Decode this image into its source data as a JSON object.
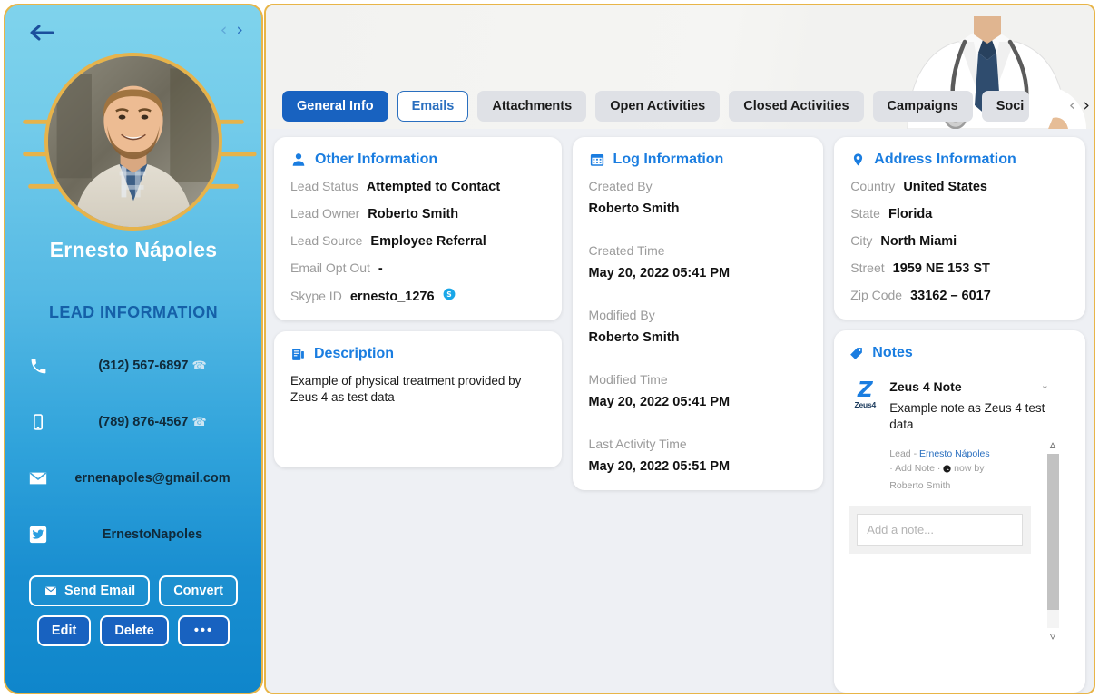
{
  "sidebar": {
    "back_icon": "back-arrow-icon",
    "prev_icon": "chevron-left-icon",
    "next_icon": "chevron-right-icon",
    "lead_name": "Ernesto Nápoles",
    "section_title": "LEAD INFORMATION",
    "contacts": [
      {
        "icon": "phone-icon",
        "value": "(312) 567-6897",
        "call_icon": "call-icon"
      },
      {
        "icon": "mobile-icon",
        "value": "(789) 876-4567",
        "call_icon": "call-icon"
      },
      {
        "icon": "email-icon",
        "value": "ernenapoles@gmail.com",
        "call_icon": ""
      },
      {
        "icon": "twitter-icon",
        "value": "ErnestoNapoles",
        "call_icon": ""
      }
    ],
    "buttons": {
      "send_email": "Send Email",
      "convert": "Convert",
      "edit": "Edit",
      "delete": "Delete",
      "more": "•••"
    }
  },
  "tabs": [
    {
      "label": "General Info",
      "state": "active"
    },
    {
      "label": "Emails",
      "state": "outlined"
    },
    {
      "label": "Attachments",
      "state": "normal"
    },
    {
      "label": "Open Activities",
      "state": "normal"
    },
    {
      "label": "Closed Activities",
      "state": "normal"
    },
    {
      "label": "Campaigns",
      "state": "normal"
    },
    {
      "label": "Soci",
      "state": "clipped"
    }
  ],
  "tab_nav": {
    "prev": "‹",
    "next": "›"
  },
  "other_information": {
    "title": "Other Information",
    "icon": "person-icon",
    "fields": [
      {
        "label": "Lead Status",
        "value": "Attempted to Contact"
      },
      {
        "label": "Lead Owner",
        "value": "Roberto Smith"
      },
      {
        "label": "Lead Source",
        "value": "Employee Referral"
      },
      {
        "label": "Email Opt Out",
        "value": "-"
      },
      {
        "label": "Skype ID",
        "value": "ernesto_1276"
      }
    ],
    "skype_icon": "skype-icon"
  },
  "description": {
    "title": "Description",
    "icon": "description-icon",
    "text": "Example of physical treatment provided by Zeus 4 as test data"
  },
  "log_information": {
    "title": "Log Information",
    "icon": "calendar-icon",
    "rows": [
      {
        "label": "Created By",
        "value": "Roberto Smith"
      },
      {
        "label": "Created Time",
        "value": "May 20, 2022 05:41 PM"
      },
      {
        "label": "Modified By",
        "value": "Roberto Smith"
      },
      {
        "label": "Modified Time",
        "value": "May 20, 2022 05:41 PM"
      },
      {
        "label": "Last Activity Time",
        "value": "May 20, 2022 05:51 PM"
      }
    ]
  },
  "address_information": {
    "title": "Address Information",
    "icon": "map-pin-icon",
    "fields": [
      {
        "label": "Country",
        "value": "United States"
      },
      {
        "label": "State",
        "value": "Florida"
      },
      {
        "label": "City",
        "value": "North Miami"
      },
      {
        "label": "Street",
        "value": "1959 NE 153 ST"
      },
      {
        "label": "Zip Code",
        "value": "33162 – 6017"
      }
    ]
  },
  "notes": {
    "title": "Notes",
    "icon": "tag-icon",
    "logo_mark": "Z",
    "logo_sub": "Zeus4",
    "note_title": "Zeus 4 Note",
    "note_text": "Example note as Zeus 4 test data",
    "meta_module": "Lead",
    "meta_dash": "-",
    "meta_record": "Ernesto Nápoles",
    "meta_action": "Add Note",
    "meta_time": "now",
    "meta_by": "by",
    "meta_user": "Roberto Smith",
    "input_placeholder": "Add a note...",
    "collapse_icon": "chevron-down-icon",
    "scroll_up_icon": "scroll-up-icon",
    "scroll_down_icon": "scroll-down-icon"
  },
  "colors": {
    "accent_blue": "#1a7de0",
    "button_blue": "#1862c0",
    "gold_border": "#e8b548",
    "label_gray": "#9b9b9b",
    "sidebar_top": "#7fd3ec",
    "sidebar_bottom": "#0f86cb"
  }
}
